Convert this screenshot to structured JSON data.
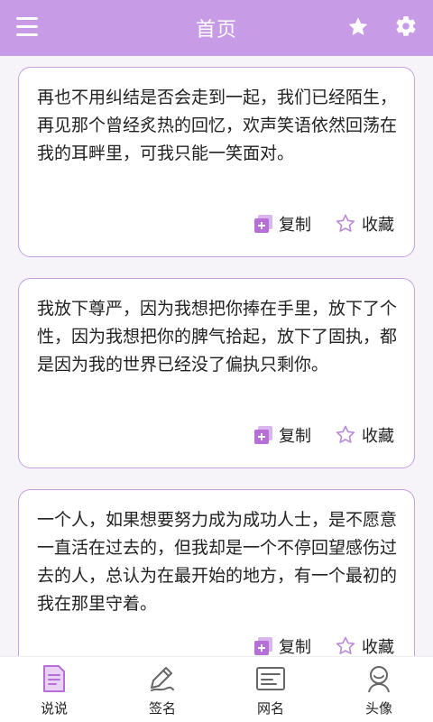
{
  "header": {
    "title": "首页",
    "menu_icon": "hamburger-menu-icon",
    "favorites_icon": "star-icon",
    "settings_icon": "gear-icon"
  },
  "cards": [
    {
      "text": "再也不用纠结是否会走到一起，我们已经陌生，再见那个曾经炙热的回忆，欢声笑语依然回荡在我的耳畔里，可我只能一笑面对。",
      "copy_label": "复制",
      "favorite_label": "收藏"
    },
    {
      "text": "我放下尊严，因为我想把你捧在手里，放下了个性，因为我想把你的脾气拾起，放下了固执，都是因为我的世界已经没了偏执只剩你。",
      "copy_label": "复制",
      "favorite_label": "收藏"
    },
    {
      "text": "一个人，如果想要努力成为成功人士，是不愿意一直活在过去的，但我却是一个不停回望感伤过去的人，总认为在最开始的地方，有一个最初的我在那里守着。",
      "copy_label": "复制",
      "favorite_label": "收藏"
    }
  ],
  "tabs": [
    {
      "label": "说说",
      "icon": "document-icon",
      "active": true
    },
    {
      "label": "签名",
      "icon": "pen-icon",
      "active": false
    },
    {
      "label": "网名",
      "icon": "id-card-icon",
      "active": false
    },
    {
      "label": "头像",
      "icon": "avatar-icon",
      "active": false
    }
  ],
  "colors": {
    "accent": "#c79be6",
    "card_border": "#c7a0de",
    "copy_icon": "#b66fd6"
  }
}
